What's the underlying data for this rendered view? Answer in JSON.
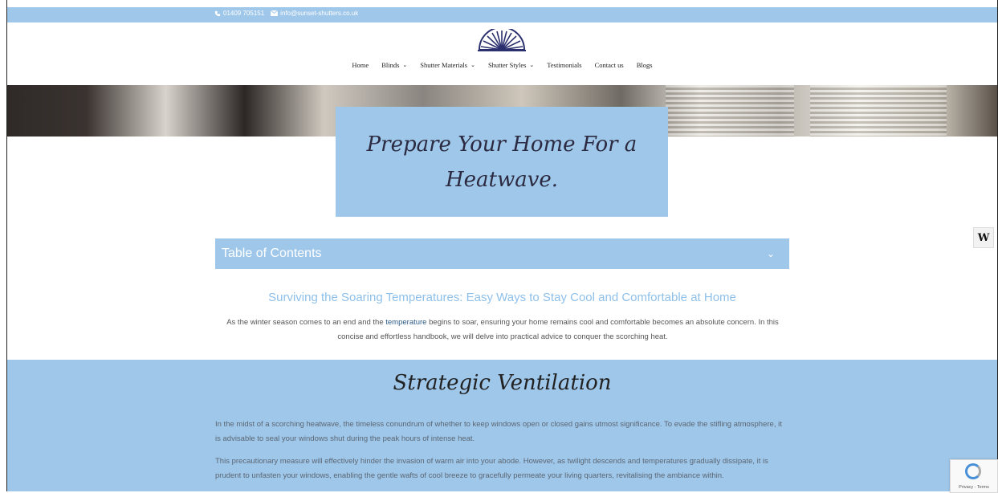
{
  "topbar": {
    "phone": "01409 705151",
    "email": "info@sunset-shutters.co.uk",
    "phone_icon": "phone-icon",
    "email_icon": "envelope-icon"
  },
  "nav": {
    "items": [
      {
        "label": "Home",
        "dropdown": false
      },
      {
        "label": "Blinds",
        "dropdown": true
      },
      {
        "label": "Shutter Materials",
        "dropdown": true
      },
      {
        "label": "Shutter Styles",
        "dropdown": true
      },
      {
        "label": "Testimonials",
        "dropdown": false
      },
      {
        "label": "Contact us",
        "dropdown": false
      },
      {
        "label": "Blogs",
        "dropdown": false
      }
    ]
  },
  "hero": {
    "title": "Prepare Your Home For a Heatwave."
  },
  "toc": {
    "label": "Table of Contents"
  },
  "intro": {
    "heading": "Surviving the Soaring Temperatures: Easy Ways to Stay Cool and Comfortable at Home",
    "text_before": "As the winter season comes to an end and the ",
    "link": "temperature",
    "text_after": " begins to soar, ensuring your home remains cool and comfortable becomes an absolute concern. In this concise and effortless handbook, we will delve into practical advice to conquer the scorching heat."
  },
  "section2": {
    "heading": "Strategic Ventilation",
    "para1": "In the midst of a scorching heatwave, the timeless conundrum of whether to keep windows open or closed gains utmost significance. To evade the stifling atmosphere, it is advisable to seal your windows shut during the peak hours of intense heat.",
    "para2": "This precautionary measure will effectively hinder the invasion of warm air into your abode. However, as twilight descends and temperatures gradually dissipate, it is prudent to unfasten your windows, enabling the gentle wafts of cool breeze to gracefully permeate your living quarters, revitalising the ambiance within."
  },
  "widgets": {
    "side_button": "W",
    "recaptcha": "Privacy - Terms"
  },
  "colors": {
    "accent": "#9fc7ea",
    "heading_blue": "#8ec0ea",
    "link": "#2b5a86"
  }
}
